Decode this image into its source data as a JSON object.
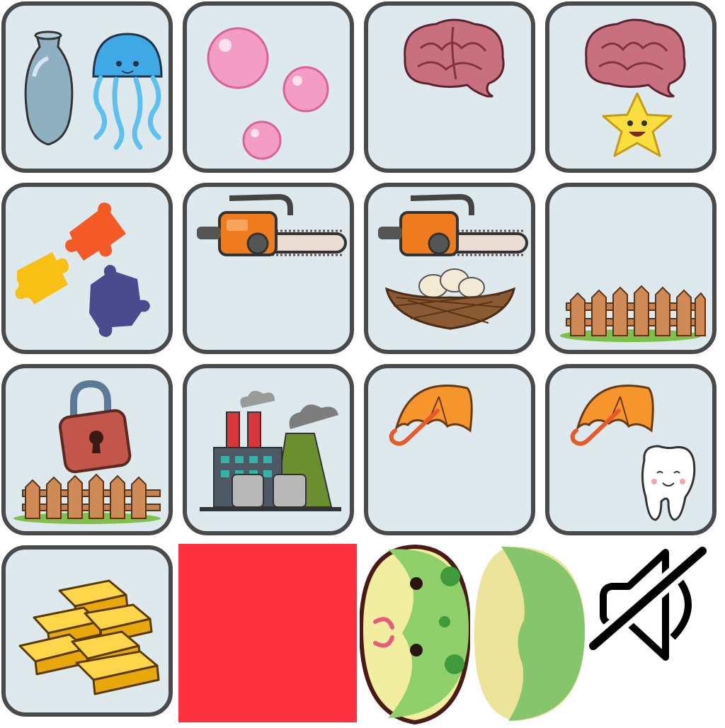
{
  "colors": {
    "card_background": "#dde9ec",
    "card_border": "#4a4a4a",
    "red_block": "#ff3040"
  },
  "board": {
    "cards": [
      {
        "row": 0,
        "col": 0,
        "items": [
          "vase",
          "jellyfish"
        ]
      },
      {
        "row": 0,
        "col": 1,
        "items": [
          "bubbles"
        ]
      },
      {
        "row": 0,
        "col": 2,
        "items": [
          "brain"
        ]
      },
      {
        "row": 0,
        "col": 3,
        "items": [
          "brain",
          "star"
        ]
      },
      {
        "row": 1,
        "col": 0,
        "items": [
          "puzzle-pieces"
        ]
      },
      {
        "row": 1,
        "col": 1,
        "items": [
          "chainsaw"
        ]
      },
      {
        "row": 1,
        "col": 2,
        "items": [
          "chainsaw",
          "nest"
        ]
      },
      {
        "row": 1,
        "col": 3,
        "items": [
          "fence"
        ]
      },
      {
        "row": 2,
        "col": 0,
        "items": [
          "padlock",
          "fence"
        ]
      },
      {
        "row": 2,
        "col": 1,
        "items": [
          "factory"
        ]
      },
      {
        "row": 2,
        "col": 2,
        "items": [
          "umbrella"
        ]
      },
      {
        "row": 2,
        "col": 3,
        "items": [
          "umbrella",
          "tooth"
        ]
      },
      {
        "row": 3,
        "col": 0,
        "items": [
          "gold-bars"
        ]
      }
    ]
  },
  "toolbar": {
    "icons": [
      "red-block",
      "frog-face-icon",
      "green-blob-icon",
      "mute-icon"
    ]
  }
}
